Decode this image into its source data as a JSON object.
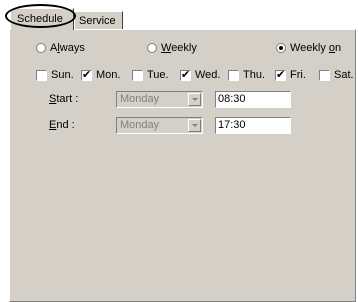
{
  "tabs": {
    "schedule": "Schedule",
    "service": "Service"
  },
  "frequency": {
    "always": {
      "before": "A",
      "accel": "l",
      "after": "ways",
      "selected": false
    },
    "weekly": {
      "before": "",
      "accel": "W",
      "after": "eekly",
      "selected": false
    },
    "weekly_on": {
      "before": "Weekly ",
      "accel": "o",
      "after": "n",
      "selected": true
    }
  },
  "days": [
    {
      "label": "Sun.",
      "checked": false
    },
    {
      "label": "Mon.",
      "checked": true
    },
    {
      "label": "Tue.",
      "checked": false
    },
    {
      "label": "Wed.",
      "checked": true
    },
    {
      "label": "Thu.",
      "checked": false
    },
    {
      "label": "Fri.",
      "checked": true
    },
    {
      "label": "Sat.",
      "checked": false
    }
  ],
  "start": {
    "accel": "S",
    "label_rest": "tart :",
    "day": "Monday",
    "time": "08:30"
  },
  "end": {
    "accel": "E",
    "label_rest": "nd :",
    "day": "Monday",
    "time": "17:30"
  },
  "colors": {
    "face": "#d4d0c8",
    "disabled_text": "#808080"
  }
}
